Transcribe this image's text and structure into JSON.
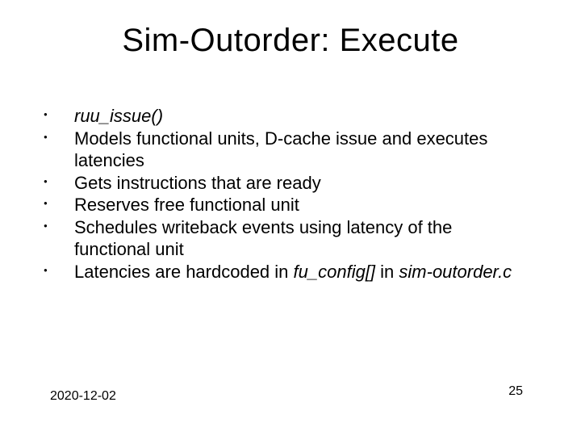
{
  "title": "Sim-Outorder: Execute",
  "bullets": {
    "b0_func": "ruu_issue()",
    "b1": "Models functional units, D-cache issue and executes latencies",
    "b2": "Gets instructions that are ready",
    "b3": "Reserves free functional unit",
    "b4": "Schedules writeback events using latency of the functional unit",
    "b5_prefix": "Latencies are hardcoded in ",
    "b5_fu": "fu_config[]",
    "b5_in": " in ",
    "b5_file": "sim-outorder.c"
  },
  "footer": {
    "date": "2020-12-02",
    "page": "25"
  }
}
